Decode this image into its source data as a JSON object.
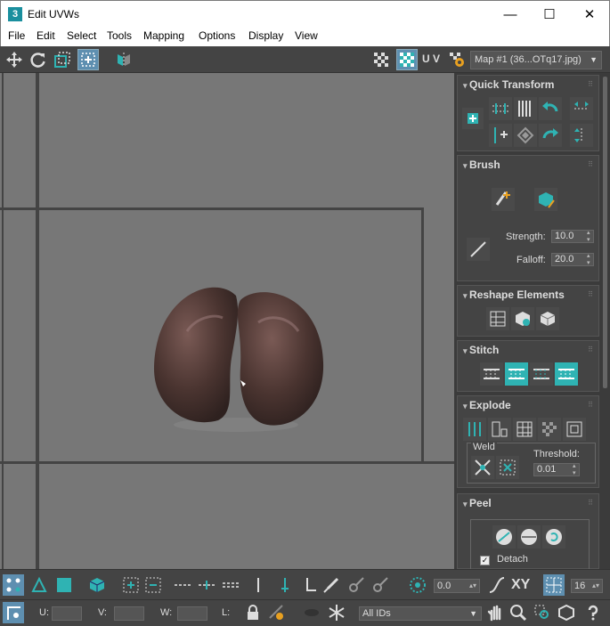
{
  "window": {
    "title": "Edit UVWs",
    "app_icon_glyph": "3",
    "minimize": "—",
    "maximize": "☐",
    "close": "✕"
  },
  "menu": {
    "items": [
      "File",
      "Edit",
      "Select",
      "Tools",
      "Mapping",
      "Options",
      "Display",
      "View"
    ]
  },
  "toolbar": {
    "uv_label": "U V",
    "map_dropdown": "Map #1 (36...OTq17.jpg)"
  },
  "colors": {
    "accent": "#2fb3b3",
    "viewport_bg": "#777777",
    "panel_bg": "#444444"
  },
  "panels": {
    "quick_transform": {
      "title": "Quick Transform"
    },
    "brush": {
      "title": "Brush",
      "strength_label": "Strength:",
      "strength_value": "10.0",
      "falloff_label": "Falloff:",
      "falloff_value": "20.0"
    },
    "reshape": {
      "title": "Reshape Elements"
    },
    "stitch": {
      "title": "Stitch"
    },
    "explode": {
      "title": "Explode",
      "weld_label": "Weld",
      "threshold_label": "Threshold:",
      "threshold_value": "0.01"
    },
    "peel": {
      "title": "Peel",
      "detach_label": "Detach",
      "detach_checked": true
    }
  },
  "bottom": {
    "angle_value": "0.0",
    "xy_label": "XY",
    "count_value": "16",
    "u_label": "U:",
    "v_label": "V:",
    "w_label": "W:",
    "l_label": "L:",
    "ids_dropdown": "All IDs"
  }
}
